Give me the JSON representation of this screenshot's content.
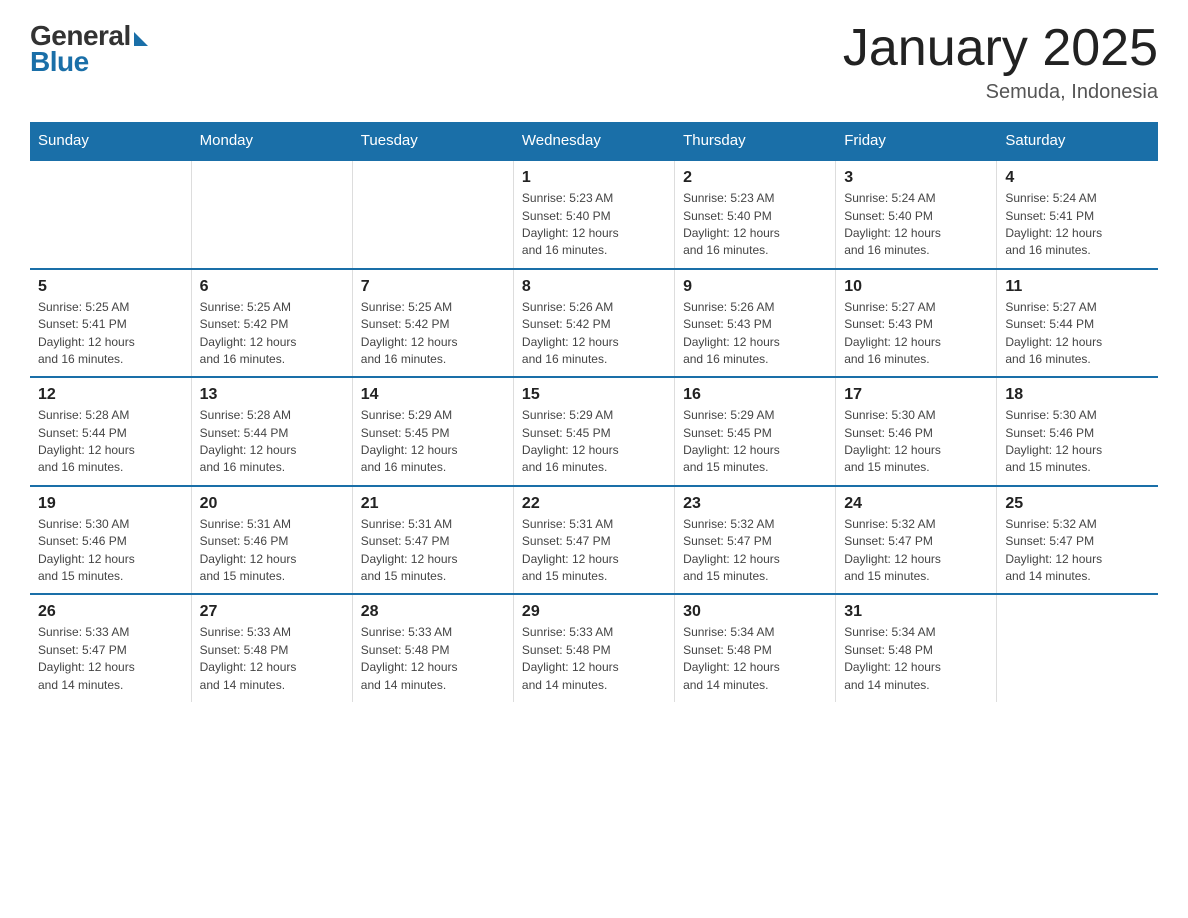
{
  "header": {
    "logo": {
      "general": "General",
      "blue": "Blue",
      "tagline": "Blue"
    },
    "title": "January 2025",
    "subtitle": "Semuda, Indonesia"
  },
  "days_of_week": [
    "Sunday",
    "Monday",
    "Tuesday",
    "Wednesday",
    "Thursday",
    "Friday",
    "Saturday"
  ],
  "weeks": [
    [
      {
        "day": "",
        "info": ""
      },
      {
        "day": "",
        "info": ""
      },
      {
        "day": "",
        "info": ""
      },
      {
        "day": "1",
        "info": "Sunrise: 5:23 AM\nSunset: 5:40 PM\nDaylight: 12 hours\nand 16 minutes."
      },
      {
        "day": "2",
        "info": "Sunrise: 5:23 AM\nSunset: 5:40 PM\nDaylight: 12 hours\nand 16 minutes."
      },
      {
        "day": "3",
        "info": "Sunrise: 5:24 AM\nSunset: 5:40 PM\nDaylight: 12 hours\nand 16 minutes."
      },
      {
        "day": "4",
        "info": "Sunrise: 5:24 AM\nSunset: 5:41 PM\nDaylight: 12 hours\nand 16 minutes."
      }
    ],
    [
      {
        "day": "5",
        "info": "Sunrise: 5:25 AM\nSunset: 5:41 PM\nDaylight: 12 hours\nand 16 minutes."
      },
      {
        "day": "6",
        "info": "Sunrise: 5:25 AM\nSunset: 5:42 PM\nDaylight: 12 hours\nand 16 minutes."
      },
      {
        "day": "7",
        "info": "Sunrise: 5:25 AM\nSunset: 5:42 PM\nDaylight: 12 hours\nand 16 minutes."
      },
      {
        "day": "8",
        "info": "Sunrise: 5:26 AM\nSunset: 5:42 PM\nDaylight: 12 hours\nand 16 minutes."
      },
      {
        "day": "9",
        "info": "Sunrise: 5:26 AM\nSunset: 5:43 PM\nDaylight: 12 hours\nand 16 minutes."
      },
      {
        "day": "10",
        "info": "Sunrise: 5:27 AM\nSunset: 5:43 PM\nDaylight: 12 hours\nand 16 minutes."
      },
      {
        "day": "11",
        "info": "Sunrise: 5:27 AM\nSunset: 5:44 PM\nDaylight: 12 hours\nand 16 minutes."
      }
    ],
    [
      {
        "day": "12",
        "info": "Sunrise: 5:28 AM\nSunset: 5:44 PM\nDaylight: 12 hours\nand 16 minutes."
      },
      {
        "day": "13",
        "info": "Sunrise: 5:28 AM\nSunset: 5:44 PM\nDaylight: 12 hours\nand 16 minutes."
      },
      {
        "day": "14",
        "info": "Sunrise: 5:29 AM\nSunset: 5:45 PM\nDaylight: 12 hours\nand 16 minutes."
      },
      {
        "day": "15",
        "info": "Sunrise: 5:29 AM\nSunset: 5:45 PM\nDaylight: 12 hours\nand 16 minutes."
      },
      {
        "day": "16",
        "info": "Sunrise: 5:29 AM\nSunset: 5:45 PM\nDaylight: 12 hours\nand 15 minutes."
      },
      {
        "day": "17",
        "info": "Sunrise: 5:30 AM\nSunset: 5:46 PM\nDaylight: 12 hours\nand 15 minutes."
      },
      {
        "day": "18",
        "info": "Sunrise: 5:30 AM\nSunset: 5:46 PM\nDaylight: 12 hours\nand 15 minutes."
      }
    ],
    [
      {
        "day": "19",
        "info": "Sunrise: 5:30 AM\nSunset: 5:46 PM\nDaylight: 12 hours\nand 15 minutes."
      },
      {
        "day": "20",
        "info": "Sunrise: 5:31 AM\nSunset: 5:46 PM\nDaylight: 12 hours\nand 15 minutes."
      },
      {
        "day": "21",
        "info": "Sunrise: 5:31 AM\nSunset: 5:47 PM\nDaylight: 12 hours\nand 15 minutes."
      },
      {
        "day": "22",
        "info": "Sunrise: 5:31 AM\nSunset: 5:47 PM\nDaylight: 12 hours\nand 15 minutes."
      },
      {
        "day": "23",
        "info": "Sunrise: 5:32 AM\nSunset: 5:47 PM\nDaylight: 12 hours\nand 15 minutes."
      },
      {
        "day": "24",
        "info": "Sunrise: 5:32 AM\nSunset: 5:47 PM\nDaylight: 12 hours\nand 15 minutes."
      },
      {
        "day": "25",
        "info": "Sunrise: 5:32 AM\nSunset: 5:47 PM\nDaylight: 12 hours\nand 14 minutes."
      }
    ],
    [
      {
        "day": "26",
        "info": "Sunrise: 5:33 AM\nSunset: 5:47 PM\nDaylight: 12 hours\nand 14 minutes."
      },
      {
        "day": "27",
        "info": "Sunrise: 5:33 AM\nSunset: 5:48 PM\nDaylight: 12 hours\nand 14 minutes."
      },
      {
        "day": "28",
        "info": "Sunrise: 5:33 AM\nSunset: 5:48 PM\nDaylight: 12 hours\nand 14 minutes."
      },
      {
        "day": "29",
        "info": "Sunrise: 5:33 AM\nSunset: 5:48 PM\nDaylight: 12 hours\nand 14 minutes."
      },
      {
        "day": "30",
        "info": "Sunrise: 5:34 AM\nSunset: 5:48 PM\nDaylight: 12 hours\nand 14 minutes."
      },
      {
        "day": "31",
        "info": "Sunrise: 5:34 AM\nSunset: 5:48 PM\nDaylight: 12 hours\nand 14 minutes."
      },
      {
        "day": "",
        "info": ""
      }
    ]
  ]
}
